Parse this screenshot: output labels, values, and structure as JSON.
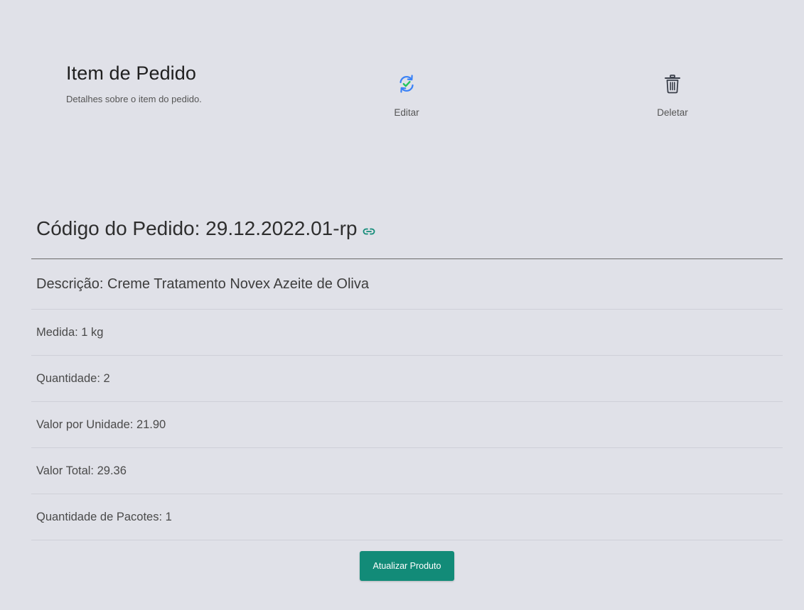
{
  "header": {
    "title": "Item de Pedido",
    "subtitle": "Detalhes sobre o item do pedido."
  },
  "actions": {
    "edit": {
      "label": "Editar",
      "icon": "refresh-check-icon"
    },
    "delete": {
      "label": "Deletar",
      "icon": "trash-icon"
    }
  },
  "order": {
    "code_text": "Código do Pedido: 29.12.2022.01-rp",
    "link_icon": "link-icon"
  },
  "details": [
    {
      "text": "Descrição: Creme Tratamento Novex Azeite de Oliva"
    },
    {
      "text": "Medida: 1 kg"
    },
    {
      "text": "Quantidade: 2"
    },
    {
      "text": "Valor por Unidade: 21.90"
    },
    {
      "text": "Valor Total: 29.36"
    },
    {
      "text": "Quantidade de Pacotes: 1"
    }
  ],
  "update_button": {
    "label": "Atualizar Produto"
  },
  "colors": {
    "background": "#e0e1e8",
    "accent": "#128b78",
    "icon_blue": "#3b82f6",
    "icon_green": "#22c55e"
  }
}
